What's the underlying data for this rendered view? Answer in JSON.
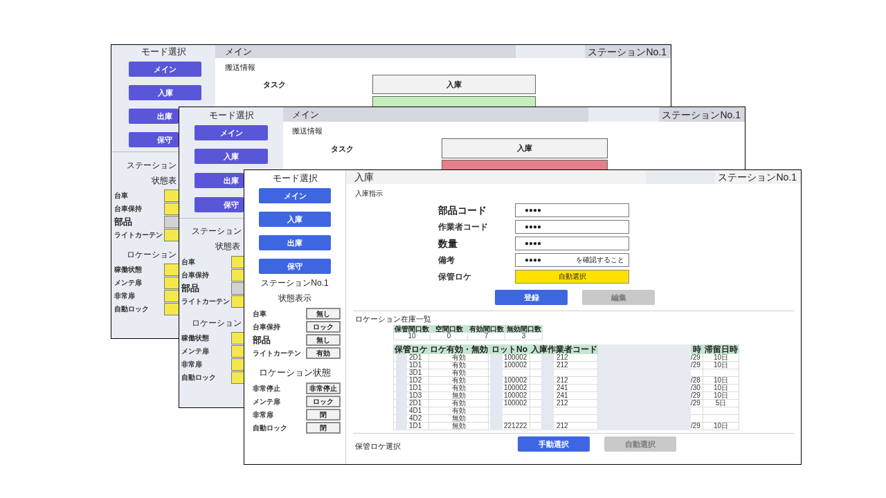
{
  "screens": [
    {
      "kind": "main",
      "sidebar": {
        "title": "モード選択",
        "mode_buttons": [
          {
            "label": "メイン"
          },
          {
            "label": "入庫"
          },
          {
            "label": "出庫"
          },
          {
            "label": "保守"
          }
        ],
        "station": "ステーション",
        "status_heading": "状態表",
        "status_rows": [
          {
            "label": "台車",
            "emphasized": false,
            "color": "#f4e84c"
          },
          {
            "label": "台車保持",
            "emphasized": false,
            "color": "#f4e84c"
          },
          {
            "label": "部品",
            "emphasized": true,
            "color": "#d2d2d2"
          },
          {
            "label": "ライトカーテン",
            "emphasized": false,
            "color": "#f4e84c"
          }
        ],
        "location_heading": "ロケーション",
        "location_rows": [
          {
            "label": "稼働状態",
            "emphasized": false,
            "color": "#f4e84c"
          },
          {
            "label": "メンテ扉",
            "emphasized": false,
            "color": "#f4e84c"
          },
          {
            "label": "非常扉",
            "emphasized": false,
            "color": "#f4e84c"
          },
          {
            "label": "自動ロック",
            "emphasized": false,
            "color": "#f4e84c"
          }
        ]
      },
      "header": {
        "title": "メイン",
        "station": "ステーションNo.1"
      },
      "section_title": "搬送情報",
      "task": {
        "label": "タスク",
        "value": "入庫"
      },
      "status_box": {
        "color": "#c4efbd"
      }
    },
    {
      "kind": "main",
      "sidebar": {
        "title": "モード選択",
        "mode_buttons": [
          {
            "label": "メイン"
          },
          {
            "label": "入庫"
          },
          {
            "label": "出庫"
          },
          {
            "label": "保守"
          }
        ],
        "station": "ステーション",
        "status_heading": "状態表",
        "status_rows": [
          {
            "label": "台車",
            "emphasized": false,
            "color": "#f4e84c"
          },
          {
            "label": "台車保持",
            "emphasized": false,
            "color": "#f4e84c"
          },
          {
            "label": "部品",
            "emphasized": true,
            "color": "#d2d2d2"
          },
          {
            "label": "ライトカーテン",
            "emphasized": false,
            "color": "#f4e84c"
          }
        ],
        "location_heading": "ロケーション",
        "location_rows": [
          {
            "label": "稼働状態",
            "emphasized": false,
            "color": "#f4e84c"
          },
          {
            "label": "メンテ扉",
            "emphasized": false,
            "color": "#f4e84c"
          },
          {
            "label": "非常扉",
            "emphasized": false,
            "color": "#f4e84c"
          },
          {
            "label": "自動ロック",
            "emphasized": false,
            "color": "#f4e84c"
          }
        ]
      },
      "header": {
        "title": "メイン",
        "station": "ステーションNo.1"
      },
      "section_title": "搬送情報",
      "task": {
        "label": "タスク",
        "value": "入庫"
      },
      "status_box": {
        "color": "#e3808a"
      }
    },
    {
      "kind": "inbound",
      "sidebar": {
        "title": "モード選択",
        "mode_buttons": [
          {
            "label": "メイン"
          },
          {
            "label": "入庫"
          },
          {
            "label": "出庫"
          },
          {
            "label": "保守"
          }
        ],
        "station": "ステーションNo.1",
        "status_heading": "状態表示",
        "status_rows": [
          {
            "label": "台車",
            "emphasized": false,
            "value": "無し"
          },
          {
            "label": "台車保持",
            "emphasized": false,
            "value": "ロック"
          },
          {
            "label": "部品",
            "emphasized": true,
            "value": "無し"
          },
          {
            "label": "ライトカーテン",
            "emphasized": false,
            "value": "有効"
          }
        ],
        "location_heading": "ロケーション状態",
        "location_rows": [
          {
            "label": "非常停止",
            "emphasized": false,
            "value": "非常停止"
          },
          {
            "label": "メンテ扉",
            "emphasized": false,
            "value": "ロック"
          },
          {
            "label": "非常扉",
            "emphasized": false,
            "value": "閉"
          },
          {
            "label": "自動ロック",
            "emphasized": false,
            "value": "閉"
          }
        ]
      },
      "header": {
        "title": "入庫",
        "station": "ステーションNo.1"
      },
      "form": {
        "title": "入庫指示",
        "fields": [
          {
            "kind": "input",
            "label": "部品コード",
            "emphasized": true,
            "value": "●●●●"
          },
          {
            "kind": "input",
            "label": "作業者コード",
            "emphasized": false,
            "value": "●●●●"
          },
          {
            "kind": "input",
            "label": "数量",
            "emphasized": true,
            "value": "●●●●"
          },
          {
            "kind": "input",
            "label": "備考",
            "emphasized": false,
            "value": "●●●●",
            "note": "を確認すること"
          },
          {
            "kind": "selector",
            "label": "保管ロケ",
            "emphasized": false,
            "value": "自動選択"
          }
        ],
        "buttons": [
          {
            "label": "登録",
            "disabled": false
          },
          {
            "label": "編集",
            "disabled": true
          }
        ]
      },
      "inventory": {
        "title": "ロケーション在庫一覧",
        "summary": {
          "columns": [
            "保管間口数",
            "空間口数",
            "有効間口数",
            "無効間口数"
          ],
          "values": [
            "10",
            "0",
            "7",
            "3"
          ]
        },
        "table": {
          "columns": [
            "保管ロケ",
            "ロケ有効・無効",
            "ロットNo",
            "入庫作業者コード",
            "時",
            "滞留日時"
          ],
          "rows": [
            {
              "location": "2D1",
              "validity": "有効",
              "lot_no": "100002",
              "worker_code": "212",
              "column_5": "/29",
              "dwell_time": "10日"
            },
            {
              "location": "1D1",
              "validity": "有効",
              "lot_no": "100002",
              "worker_code": "212",
              "column_5": "/29",
              "dwell_time": "10日"
            },
            {
              "location": "3D1",
              "validity": "有効"
            },
            {
              "location": "1D2",
              "validity": "有効",
              "lot_no": "100002",
              "worker_code": "212",
              "column_5": "/28",
              "dwell_time": "10日"
            },
            {
              "location": "1D1",
              "validity": "有効",
              "lot_no": "100002",
              "worker_code": "241",
              "column_5": "/30",
              "dwell_time": "10日"
            },
            {
              "location": "1D3",
              "validity": "無効",
              "lot_no": "100002",
              "worker_code": "241",
              "column_5": "/29",
              "dwell_time": "10日"
            },
            {
              "location": "2D1",
              "validity": "有効",
              "lot_no": "100002",
              "worker_code": "212",
              "column_5": "/29",
              "dwell_time": "5日"
            },
            {
              "location": "4D1",
              "validity": "有効"
            },
            {
              "location": "4D2",
              "validity": "無効"
            },
            {
              "location": "1D1",
              "validity": "無効",
              "lot_no": "221222",
              "worker_code": "212",
              "column_5": "/29",
              "dwell_time": "10日"
            }
          ]
        }
      },
      "location_select": {
        "title": "保管ロケ選択",
        "buttons": [
          {
            "label": "手動選択",
            "disabled": false
          },
          {
            "label": "自動選択",
            "disabled": true
          }
        ]
      }
    }
  ]
}
